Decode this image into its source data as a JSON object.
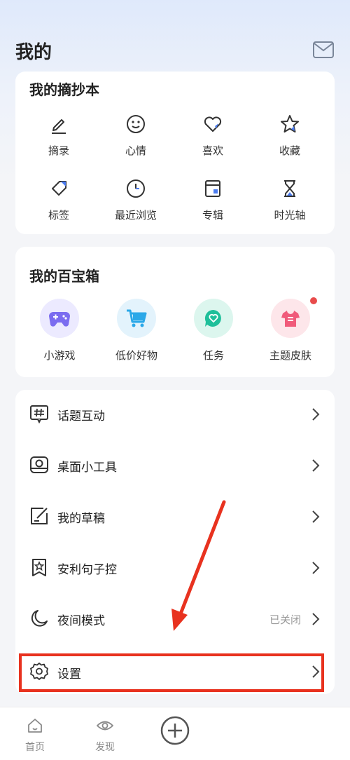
{
  "header": {
    "title": "我的"
  },
  "notebook": {
    "title": "我的摘抄本",
    "items": [
      {
        "label": "摘录",
        "icon": "pencil-icon"
      },
      {
        "label": "心情",
        "icon": "smiley-icon"
      },
      {
        "label": "喜欢",
        "icon": "heart-icon"
      },
      {
        "label": "收藏",
        "icon": "star-icon"
      },
      {
        "label": "标签",
        "icon": "tag-icon"
      },
      {
        "label": "最近浏览",
        "icon": "clock-icon"
      },
      {
        "label": "专辑",
        "icon": "album-icon"
      },
      {
        "label": "时光轴",
        "icon": "hourglass-icon"
      }
    ]
  },
  "toolbox": {
    "title": "我的百宝箱",
    "items": [
      {
        "label": "小游戏",
        "icon": "gamepad-icon",
        "color": "#7b6cf0"
      },
      {
        "label": "低价好物",
        "icon": "cart-icon",
        "color": "#2ba8e8"
      },
      {
        "label": "任务",
        "icon": "chat-bubble-icon",
        "color": "#1fbf9a"
      },
      {
        "label": "主题皮肤",
        "icon": "tshirt-icon",
        "color": "#f05a7a"
      }
    ]
  },
  "menu": {
    "items": [
      {
        "label": "话题互动",
        "icon": "hashtag-icon",
        "value": ""
      },
      {
        "label": "桌面小工具",
        "icon": "widget-icon",
        "value": ""
      },
      {
        "label": "我的草稿",
        "icon": "draft-icon",
        "value": ""
      },
      {
        "label": "安利句子控",
        "icon": "bookmark-star-icon",
        "value": ""
      },
      {
        "label": "夜间模式",
        "icon": "moon-icon",
        "value": "已关闭"
      }
    ],
    "settings": {
      "label": "设置",
      "icon": "gear-icon"
    }
  },
  "tabbar": {
    "tabs": [
      {
        "label": "首页",
        "icon": "home-icon"
      },
      {
        "label": "发现",
        "icon": "eye-icon"
      }
    ],
    "add_icon": "plus-circle-icon"
  },
  "colors": {
    "accent_red": "#e8321f",
    "badge_red": "#e84b4b"
  }
}
